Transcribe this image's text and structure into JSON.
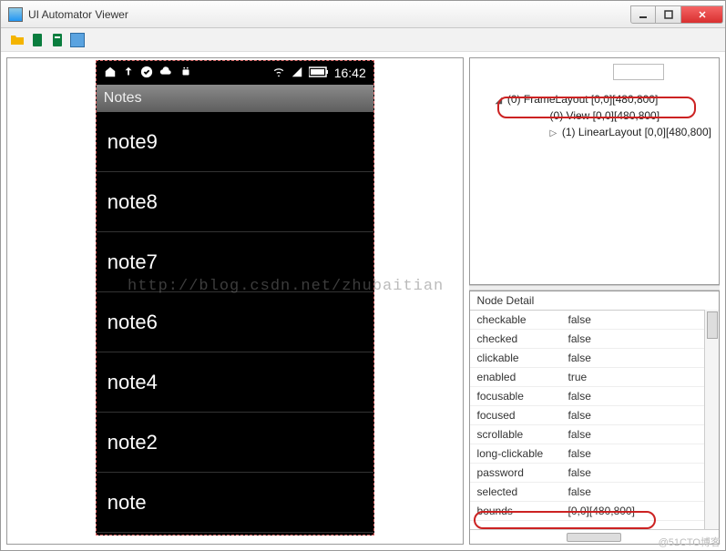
{
  "window": {
    "title": "UI Automator Viewer"
  },
  "device": {
    "clock": "16:42",
    "app_title": "Notes",
    "notes": [
      "note9",
      "note8",
      "note7",
      "note6",
      "note4",
      "note2",
      "note"
    ]
  },
  "tree": {
    "root": "(0) FrameLayout [0,0][480,800]",
    "children": [
      "(0) View [0,0][480,800]",
      "(1) LinearLayout [0,0][480,800]"
    ]
  },
  "node_detail": {
    "header": "Node Detail",
    "rows": [
      {
        "k": "checkable",
        "v": "false"
      },
      {
        "k": "checked",
        "v": "false"
      },
      {
        "k": "clickable",
        "v": "false"
      },
      {
        "k": "enabled",
        "v": "true"
      },
      {
        "k": "focusable",
        "v": "false"
      },
      {
        "k": "focused",
        "v": "false"
      },
      {
        "k": "scrollable",
        "v": "false"
      },
      {
        "k": "long-clickable",
        "v": "false"
      },
      {
        "k": "password",
        "v": "false"
      },
      {
        "k": "selected",
        "v": "false"
      },
      {
        "k": "bounds",
        "v": "[0,0][480,800]"
      }
    ]
  },
  "watermark": "http://blog.csdn.net/zhubaitian",
  "stamp": "@51CTO博客"
}
